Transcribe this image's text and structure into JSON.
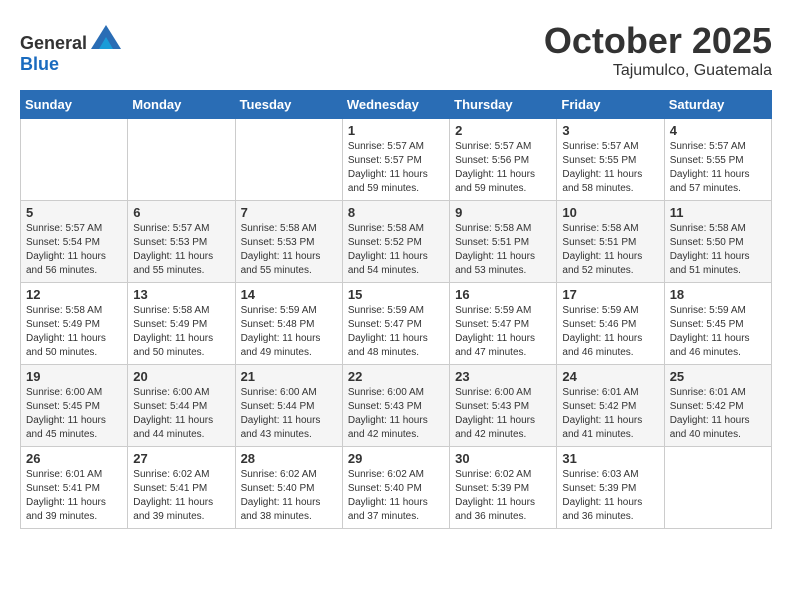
{
  "header": {
    "logo_general": "General",
    "logo_blue": "Blue",
    "month": "October 2025",
    "location": "Tajumulco, Guatemala"
  },
  "days_of_week": [
    "Sunday",
    "Monday",
    "Tuesday",
    "Wednesday",
    "Thursday",
    "Friday",
    "Saturday"
  ],
  "weeks": [
    [
      {
        "day": "",
        "info": ""
      },
      {
        "day": "",
        "info": ""
      },
      {
        "day": "",
        "info": ""
      },
      {
        "day": "1",
        "info": "Sunrise: 5:57 AM\nSunset: 5:57 PM\nDaylight: 11 hours\nand 59 minutes."
      },
      {
        "day": "2",
        "info": "Sunrise: 5:57 AM\nSunset: 5:56 PM\nDaylight: 11 hours\nand 59 minutes."
      },
      {
        "day": "3",
        "info": "Sunrise: 5:57 AM\nSunset: 5:55 PM\nDaylight: 11 hours\nand 58 minutes."
      },
      {
        "day": "4",
        "info": "Sunrise: 5:57 AM\nSunset: 5:55 PM\nDaylight: 11 hours\nand 57 minutes."
      }
    ],
    [
      {
        "day": "5",
        "info": "Sunrise: 5:57 AM\nSunset: 5:54 PM\nDaylight: 11 hours\nand 56 minutes."
      },
      {
        "day": "6",
        "info": "Sunrise: 5:57 AM\nSunset: 5:53 PM\nDaylight: 11 hours\nand 55 minutes."
      },
      {
        "day": "7",
        "info": "Sunrise: 5:58 AM\nSunset: 5:53 PM\nDaylight: 11 hours\nand 55 minutes."
      },
      {
        "day": "8",
        "info": "Sunrise: 5:58 AM\nSunset: 5:52 PM\nDaylight: 11 hours\nand 54 minutes."
      },
      {
        "day": "9",
        "info": "Sunrise: 5:58 AM\nSunset: 5:51 PM\nDaylight: 11 hours\nand 53 minutes."
      },
      {
        "day": "10",
        "info": "Sunrise: 5:58 AM\nSunset: 5:51 PM\nDaylight: 11 hours\nand 52 minutes."
      },
      {
        "day": "11",
        "info": "Sunrise: 5:58 AM\nSunset: 5:50 PM\nDaylight: 11 hours\nand 51 minutes."
      }
    ],
    [
      {
        "day": "12",
        "info": "Sunrise: 5:58 AM\nSunset: 5:49 PM\nDaylight: 11 hours\nand 50 minutes."
      },
      {
        "day": "13",
        "info": "Sunrise: 5:58 AM\nSunset: 5:49 PM\nDaylight: 11 hours\nand 50 minutes."
      },
      {
        "day": "14",
        "info": "Sunrise: 5:59 AM\nSunset: 5:48 PM\nDaylight: 11 hours\nand 49 minutes."
      },
      {
        "day": "15",
        "info": "Sunrise: 5:59 AM\nSunset: 5:47 PM\nDaylight: 11 hours\nand 48 minutes."
      },
      {
        "day": "16",
        "info": "Sunrise: 5:59 AM\nSunset: 5:47 PM\nDaylight: 11 hours\nand 47 minutes."
      },
      {
        "day": "17",
        "info": "Sunrise: 5:59 AM\nSunset: 5:46 PM\nDaylight: 11 hours\nand 46 minutes."
      },
      {
        "day": "18",
        "info": "Sunrise: 5:59 AM\nSunset: 5:45 PM\nDaylight: 11 hours\nand 46 minutes."
      }
    ],
    [
      {
        "day": "19",
        "info": "Sunrise: 6:00 AM\nSunset: 5:45 PM\nDaylight: 11 hours\nand 45 minutes."
      },
      {
        "day": "20",
        "info": "Sunrise: 6:00 AM\nSunset: 5:44 PM\nDaylight: 11 hours\nand 44 minutes."
      },
      {
        "day": "21",
        "info": "Sunrise: 6:00 AM\nSunset: 5:44 PM\nDaylight: 11 hours\nand 43 minutes."
      },
      {
        "day": "22",
        "info": "Sunrise: 6:00 AM\nSunset: 5:43 PM\nDaylight: 11 hours\nand 42 minutes."
      },
      {
        "day": "23",
        "info": "Sunrise: 6:00 AM\nSunset: 5:43 PM\nDaylight: 11 hours\nand 42 minutes."
      },
      {
        "day": "24",
        "info": "Sunrise: 6:01 AM\nSunset: 5:42 PM\nDaylight: 11 hours\nand 41 minutes."
      },
      {
        "day": "25",
        "info": "Sunrise: 6:01 AM\nSunset: 5:42 PM\nDaylight: 11 hours\nand 40 minutes."
      }
    ],
    [
      {
        "day": "26",
        "info": "Sunrise: 6:01 AM\nSunset: 5:41 PM\nDaylight: 11 hours\nand 39 minutes."
      },
      {
        "day": "27",
        "info": "Sunrise: 6:02 AM\nSunset: 5:41 PM\nDaylight: 11 hours\nand 39 minutes."
      },
      {
        "day": "28",
        "info": "Sunrise: 6:02 AM\nSunset: 5:40 PM\nDaylight: 11 hours\nand 38 minutes."
      },
      {
        "day": "29",
        "info": "Sunrise: 6:02 AM\nSunset: 5:40 PM\nDaylight: 11 hours\nand 37 minutes."
      },
      {
        "day": "30",
        "info": "Sunrise: 6:02 AM\nSunset: 5:39 PM\nDaylight: 11 hours\nand 36 minutes."
      },
      {
        "day": "31",
        "info": "Sunrise: 6:03 AM\nSunset: 5:39 PM\nDaylight: 11 hours\nand 36 minutes."
      },
      {
        "day": "",
        "info": ""
      }
    ]
  ],
  "colors": {
    "header_bg": "#2a6db5",
    "header_text": "#ffffff",
    "accent": "#1a6bbf"
  }
}
